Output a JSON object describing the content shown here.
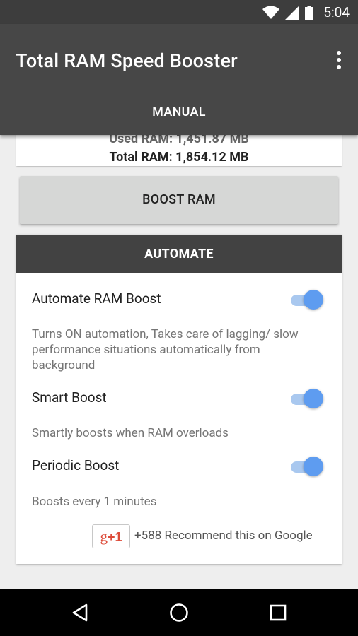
{
  "status_bar": {
    "time": "5:04",
    "icons": [
      "wifi-icon",
      "cell-signal-icon",
      "battery-icon"
    ]
  },
  "app_bar": {
    "title": "Total RAM Speed Booster",
    "menu_icon": "more-vert-icon",
    "tab_label": "MANUAL"
  },
  "ram_info": {
    "used": "Used RAM: 1,451.87 MB",
    "total": "Total RAM: 1,854.12 MB"
  },
  "boost_button": {
    "label": "BOOST RAM"
  },
  "automate": {
    "header": "AUTOMATE",
    "settings": [
      {
        "label": "Automate RAM Boost",
        "description": "Turns ON automation, Takes care of lagging/ slow performance situations automatically from background",
        "enabled": true
      },
      {
        "label": "Smart Boost",
        "description": "Smartly boosts when RAM overloads",
        "enabled": true
      },
      {
        "label": "Periodic Boost",
        "description": "Boosts every 1 minutes",
        "enabled": true
      }
    ],
    "gplus": {
      "button_text": "g",
      "button_suffix": "+1",
      "recommend_text": "+588 Recommend this on Google"
    }
  },
  "colors": {
    "toolbar": "#474747",
    "status_bar": "#3d3d3d",
    "accent": "#5e9cf0",
    "section_header": "#424242"
  },
  "nav_bar": {
    "icons": [
      "back-icon",
      "home-icon",
      "recents-icon"
    ]
  }
}
